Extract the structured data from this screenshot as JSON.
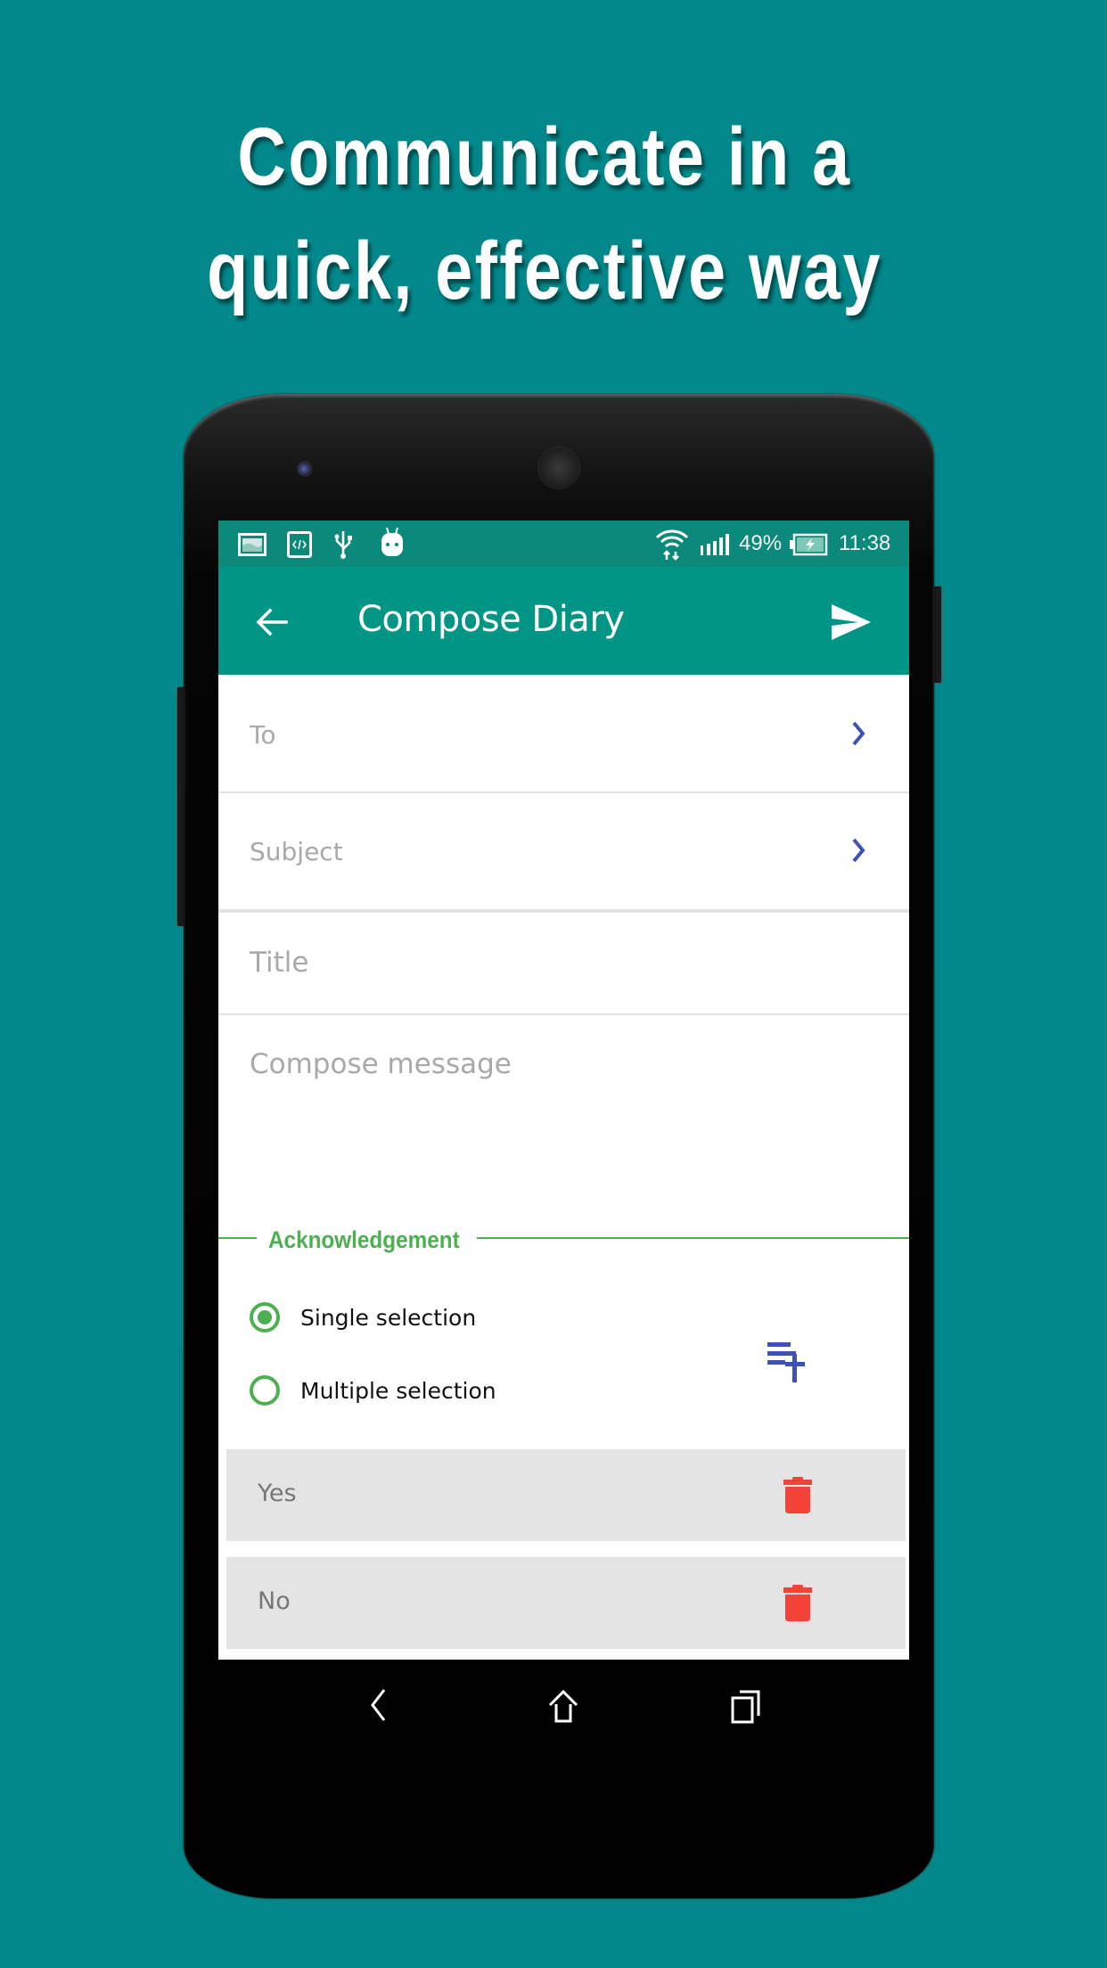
{
  "promo": {
    "headline_line1": "Communicate in a",
    "headline_line2": "quick, effective way"
  },
  "status_bar": {
    "left_icons": [
      "gallery-icon",
      "code-icon",
      "usb-icon",
      "android-icon"
    ],
    "wifi_icon": "wifi-icon",
    "signal_icon": "signal-icon",
    "battery_percent": "49%",
    "battery_icon": "battery-charging-icon",
    "time": "11:38"
  },
  "app_bar": {
    "title": "Compose Diary",
    "back_icon": "arrow-back-icon",
    "send_icon": "send-icon",
    "color": "#009585"
  },
  "form": {
    "to_placeholder": "To",
    "subject_placeholder": "Subject",
    "title_placeholder": "Title",
    "message_placeholder": "Compose message"
  },
  "acknowledgement": {
    "label": "Acknowledgement",
    "accent_color": "#4caf50",
    "options": [
      {
        "label": "Single selection",
        "checked": true
      },
      {
        "label": "Multiple selection",
        "checked": false
      }
    ],
    "add_icon": "playlist-add-icon",
    "answers": [
      {
        "text": "Yes",
        "delete_icon": "trash-icon"
      },
      {
        "text": "No",
        "delete_icon": "trash-icon"
      }
    ]
  },
  "nav_bar": {
    "back": "nav-back-icon",
    "home": "nav-home-icon",
    "recents": "nav-recents-icon"
  },
  "colors": {
    "background": "#02878a",
    "chevron": "#3f51b5",
    "delete": "#f44336"
  }
}
